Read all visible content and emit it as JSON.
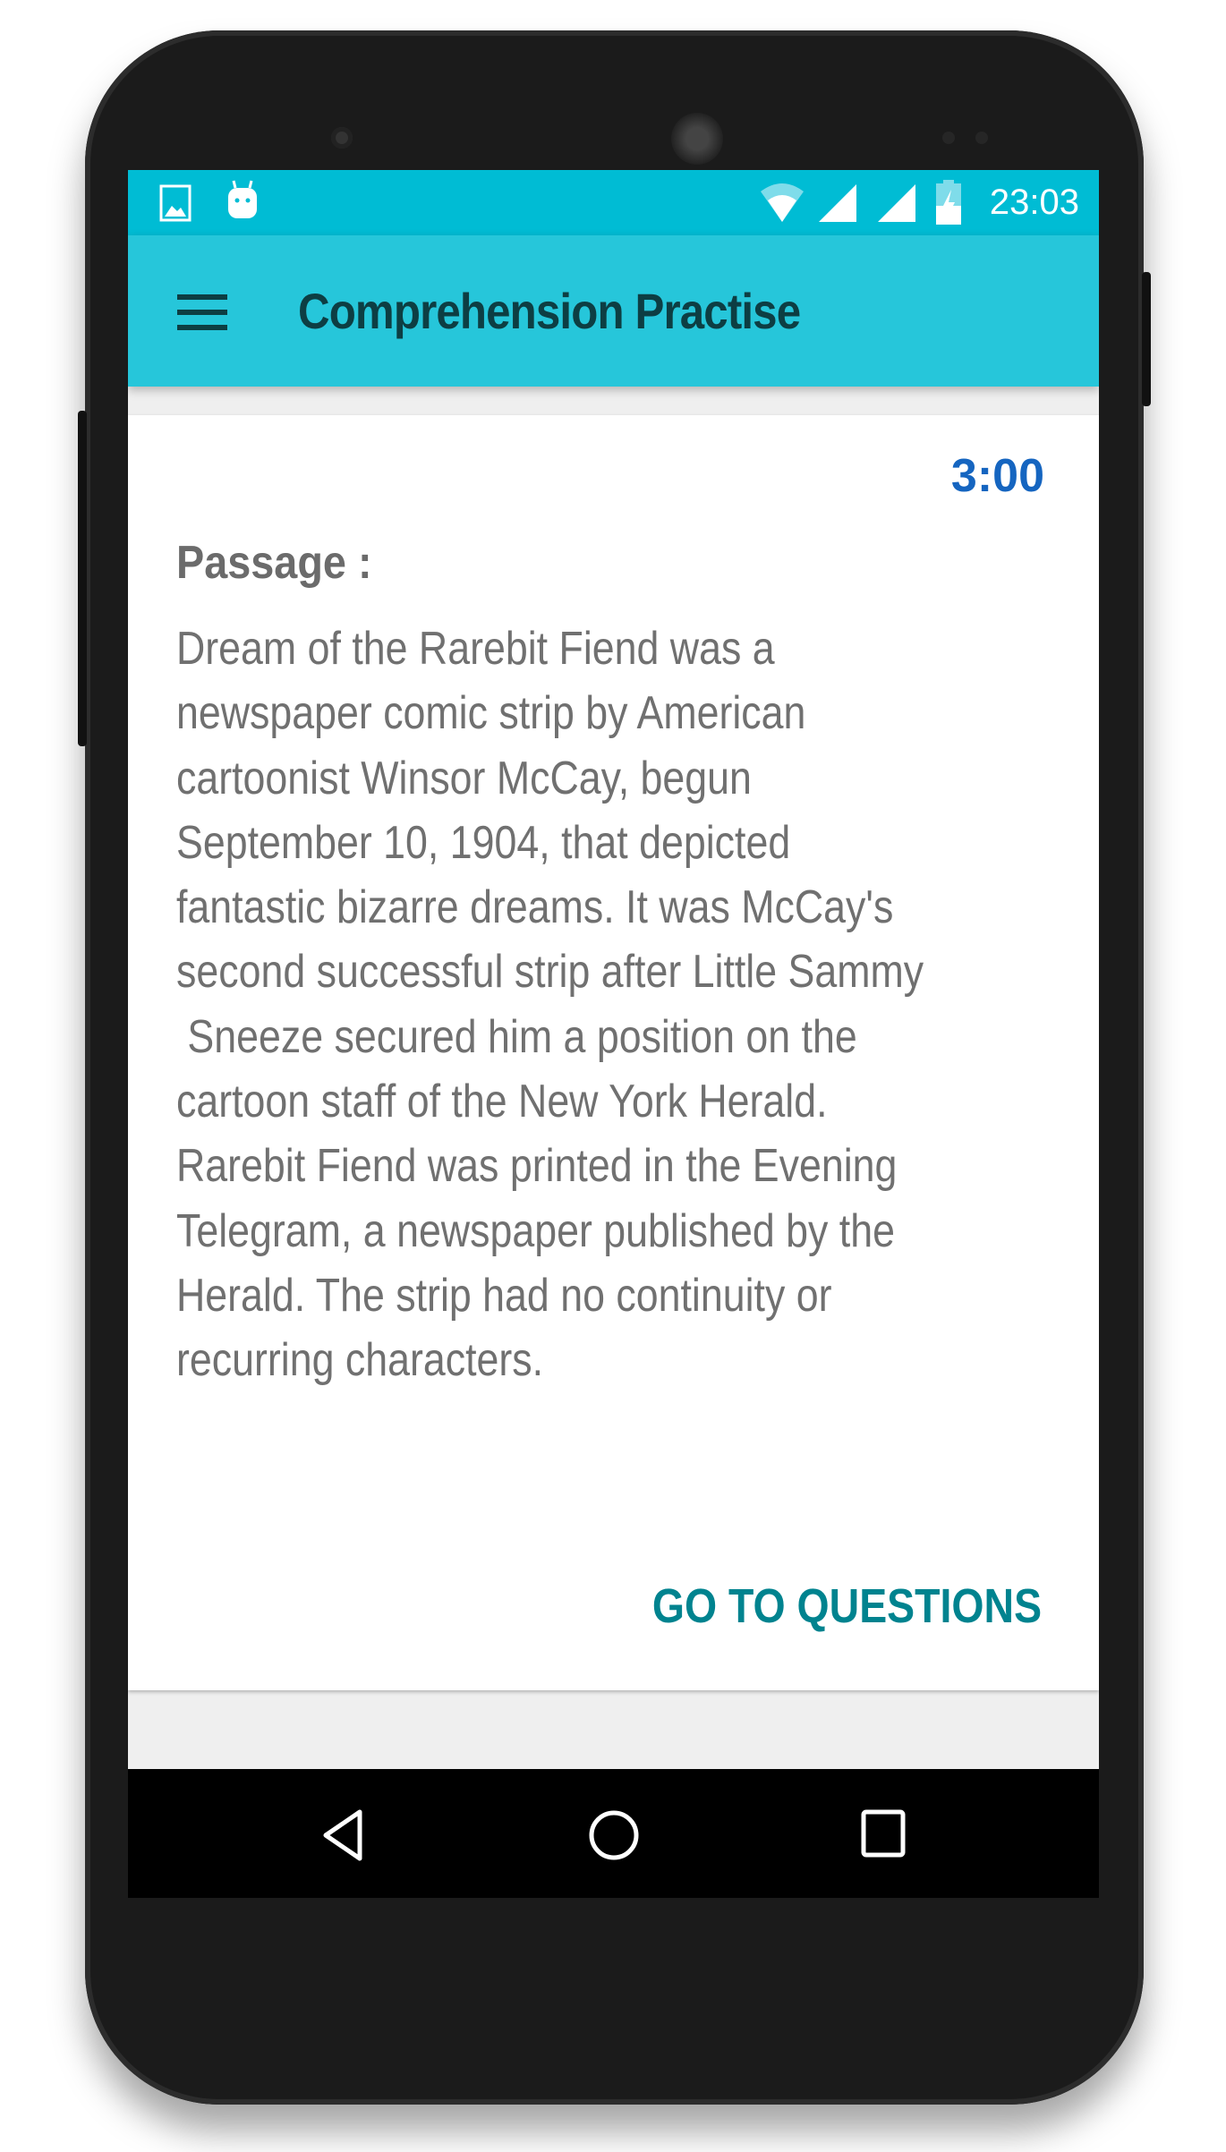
{
  "status_bar": {
    "time": "23:03",
    "icons": [
      "image-icon",
      "android-icon",
      "wifi-icon",
      "signal-icon",
      "signal-icon",
      "battery-charging-icon"
    ],
    "color": "#00bcd4"
  },
  "toolbar": {
    "title": "Comprehension Practise",
    "menu_icon": "hamburger-menu-icon",
    "color": "#26c6da"
  },
  "card": {
    "timer": "3:00",
    "passage_label": "Passage :",
    "passage_lines": [
      "Dream of the Rarebit Fiend was a",
      "newspaper comic strip by American",
      "cartoonist Winsor McCay, begun",
      "September 10, 1904, that depicted",
      "fantastic bizarre dreams. It was McCay's",
      "second successful strip after Little Sammy",
      " Sneeze secured him a position on the",
      "cartoon staff of the New York Herald.",
      "Rarebit Fiend was printed in the Evening",
      "Telegram, a newspaper published by the",
      "Herald. The strip had no continuity or",
      "recurring characters."
    ],
    "button_label": "GO TO QUESTIONS",
    "accent_color": "#00838f"
  },
  "nav_bar": {
    "icons": [
      "back-icon",
      "home-icon",
      "recents-icon"
    ]
  }
}
